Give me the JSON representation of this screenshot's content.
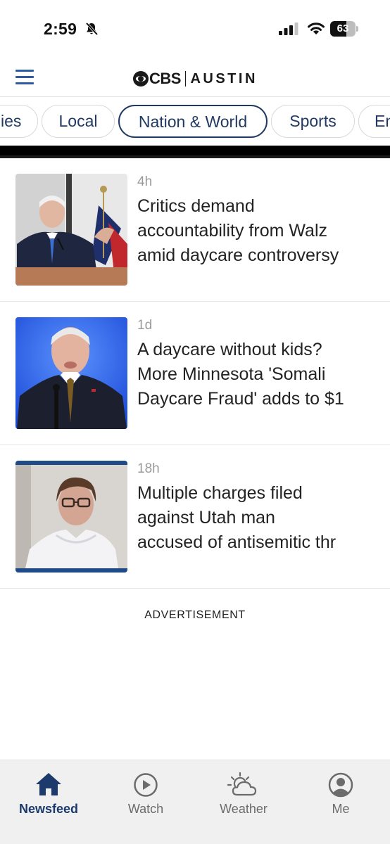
{
  "status_bar": {
    "time": "2:59",
    "battery_percent": 63,
    "battery_label": "63"
  },
  "header": {
    "logo_brand": "CBS",
    "logo_city": "AUSTIN"
  },
  "tabs": [
    {
      "label": "ies",
      "active": false
    },
    {
      "label": "Local",
      "active": false
    },
    {
      "label": "Nation & World",
      "active": true
    },
    {
      "label": "Sports",
      "active": false
    },
    {
      "label": "En",
      "active": false
    }
  ],
  "stories": [
    {
      "age": "4h",
      "headline_lines": [
        "Critics demand",
        "accountability from Walz",
        "amid daycare controversy"
      ]
    },
    {
      "age": "1d",
      "headline_lines": [
        "A daycare without kids?",
        "More Minnesota 'Somali",
        "Daycare Fraud' adds to $1"
      ]
    },
    {
      "age": "18h",
      "headline_lines": [
        "Multiple charges filed",
        "against Utah man",
        "accused of antisemitic thr"
      ]
    }
  ],
  "advertisement_label": "ADVERTISEMENT",
  "bottom_nav": [
    {
      "label": "Newsfeed",
      "icon": "home-icon",
      "active": true
    },
    {
      "label": "Watch",
      "icon": "play-circle-icon",
      "active": false
    },
    {
      "label": "Weather",
      "icon": "partly-cloudy-icon",
      "active": false
    },
    {
      "label": "Me",
      "icon": "user-circle-icon",
      "active": false
    }
  ],
  "colors": {
    "accent": "#203a63",
    "nav_active": "#1c3a6c",
    "menu_icon": "#2d5aa0"
  }
}
